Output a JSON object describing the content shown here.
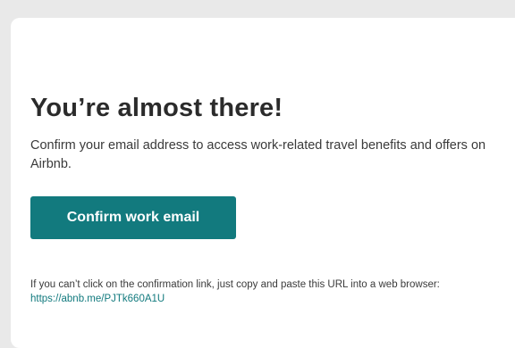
{
  "email": {
    "title": "You’re almost there!",
    "description": "Confirm your email address to access work-related travel benefits and offers on Airbnb.",
    "confirm_button_label": "Confirm work email",
    "footer_text": "If you can’t click on the confirmation link, just copy and paste this URL into a web browser: ",
    "confirmation_link": "https://abnb.me/PJTk660A1U"
  },
  "colors": {
    "accent": "#127a7e",
    "text": "#2b2b2b",
    "background": "#e9e9e9",
    "card": "#ffffff"
  }
}
